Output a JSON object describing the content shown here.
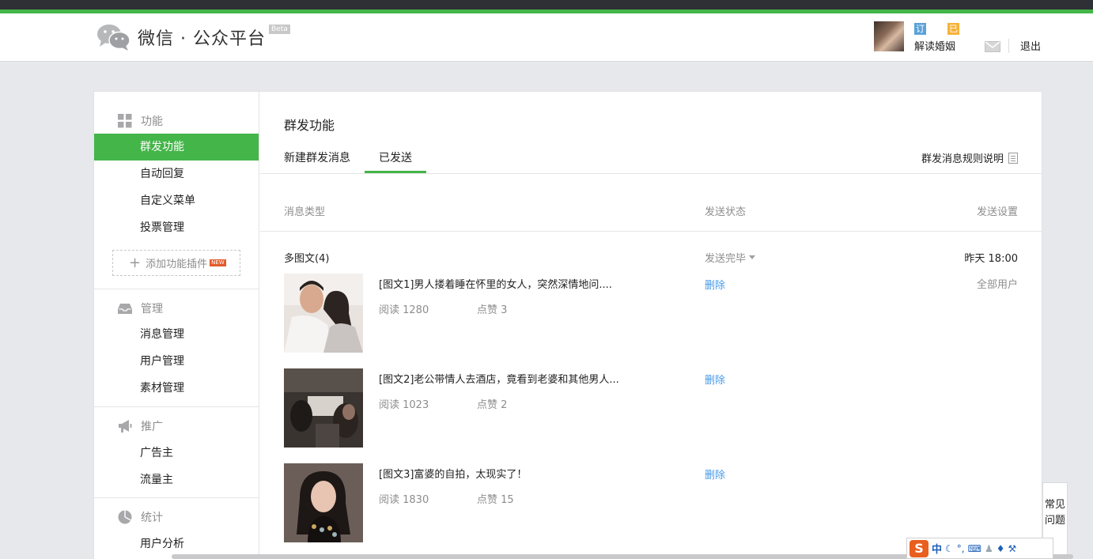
{
  "header": {
    "logo_text": "微信 · 公众平台",
    "beta": "Beta",
    "badge_subscription": "订阅号",
    "badge_verified": "已认证",
    "username": "解读婚姻",
    "logout": "退出"
  },
  "sidebar": {
    "groups": [
      {
        "title": "功能",
        "icon": "grid-icon",
        "items": [
          "群发功能",
          "自动回复",
          "自定义菜单",
          "投票管理"
        ]
      },
      {
        "title": "管理",
        "icon": "inbox-icon",
        "items": [
          "消息管理",
          "用户管理",
          "素材管理"
        ]
      },
      {
        "title": "推广",
        "icon": "megaphone-icon",
        "items": [
          "广告主",
          "流量主"
        ]
      },
      {
        "title": "统计",
        "icon": "pie-chart-icon",
        "items": [
          "用户分析"
        ]
      }
    ],
    "active_item": "群发功能",
    "add_plugin": "添加功能插件",
    "new_tag": "NEW"
  },
  "main": {
    "title": "群发功能",
    "tabs": [
      "新建群发消息",
      "已发送"
    ],
    "active_tab": "已发送",
    "rules_link": "群发消息规则说明",
    "columns": [
      "消息类型",
      "发送状态",
      "发送设置"
    ],
    "message": {
      "type": "多图文(4)",
      "status": "发送完毕",
      "time": "昨天 18:00",
      "audience": "全部用户",
      "articles": [
        {
          "title": "[图文1]男人搂着睡在怀里的女人，突然深情地问....",
          "reads": "阅读 1280",
          "likes": "点赞 3",
          "delete": "删除"
        },
        {
          "title": "[图文2]老公带情人去酒店，竟看到老婆和其他男人...",
          "reads": "阅读 1023",
          "likes": "点赞 2",
          "delete": "删除"
        },
        {
          "title": "[图文3]富婆的自拍，太现实了！",
          "reads": "阅读 1830",
          "likes": "点赞 15",
          "delete": "删除"
        }
      ]
    }
  },
  "faq": "常见问题",
  "ime": {
    "logo": "S",
    "lang": "中"
  },
  "colors": {
    "accent": "#44b549",
    "link": "#459ae9",
    "muted": "#8d8d8d"
  }
}
